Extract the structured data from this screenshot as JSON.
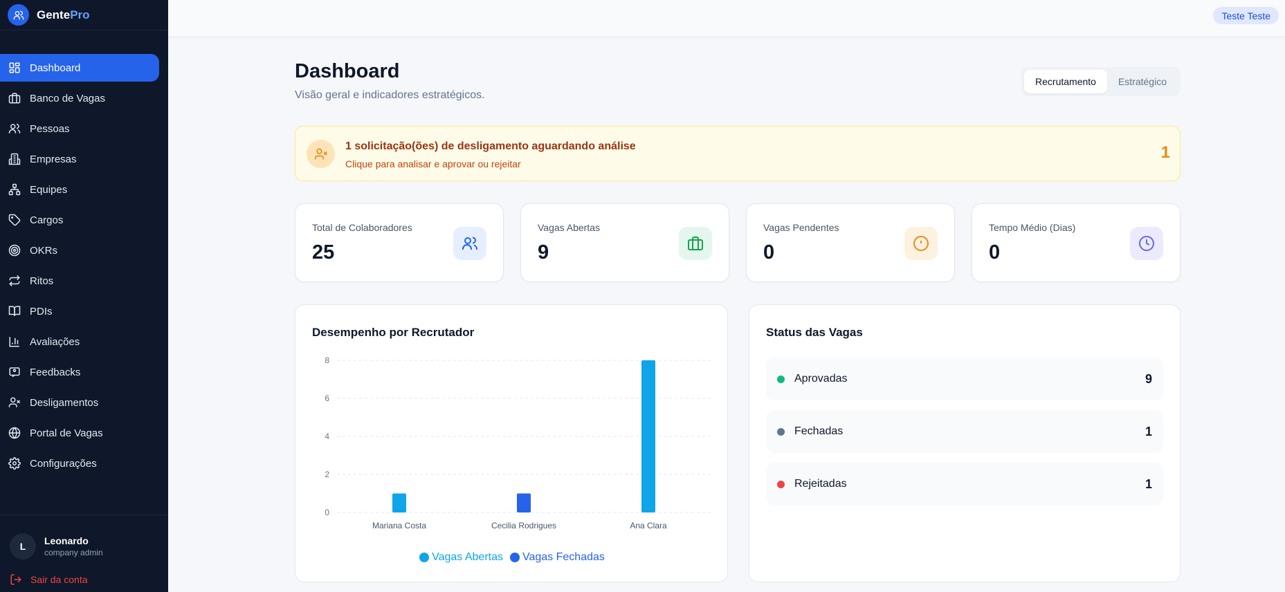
{
  "brand": {
    "name_a": "Gente",
    "name_b": "Pro"
  },
  "sidebar": {
    "items": [
      {
        "label": "Dashboard",
        "icon": "layout-grid-icon",
        "active": true
      },
      {
        "label": "Banco de Vagas",
        "icon": "briefcase-icon"
      },
      {
        "label": "Pessoas",
        "icon": "users-icon"
      },
      {
        "label": "Empresas",
        "icon": "building-icon"
      },
      {
        "label": "Equipes",
        "icon": "network-icon"
      },
      {
        "label": "Cargos",
        "icon": "tag-icon"
      },
      {
        "label": "OKRs",
        "icon": "target-icon"
      },
      {
        "label": "Ritos",
        "icon": "repeat-icon"
      },
      {
        "label": "PDIs",
        "icon": "book-icon"
      },
      {
        "label": "Avaliações",
        "icon": "bar-chart-icon"
      },
      {
        "label": "Feedbacks",
        "icon": "message-icon"
      },
      {
        "label": "Desligamentos",
        "icon": "user-x-icon"
      },
      {
        "label": "Portal de Vagas",
        "icon": "globe-icon"
      },
      {
        "label": "Configurações",
        "icon": "gear-icon"
      }
    ],
    "user": {
      "initial": "L",
      "name": "Leonardo",
      "role": "company admin"
    },
    "logout": "Sair da conta"
  },
  "topbar": {
    "user_chip": "Teste Teste"
  },
  "page": {
    "title": "Dashboard",
    "subtitle": "Visão geral e indicadores estratégicos.",
    "tabs": [
      {
        "label": "Recrutamento",
        "active": true
      },
      {
        "label": "Estratégico"
      }
    ]
  },
  "alert": {
    "title": "1 solicitação(ões) de desligamento aguardando análise",
    "subtitle": "Clique para analisar e aprovar ou rejeitar",
    "count": "1"
  },
  "stats": [
    {
      "label": "Total de Colaboradores",
      "value": "25",
      "icon": "users-icon",
      "color": "#2563eb",
      "bg": "#e6efff"
    },
    {
      "label": "Vagas Abertas",
      "value": "9",
      "icon": "briefcase-icon",
      "color": "#16a34a",
      "bg": "#e3f7ee"
    },
    {
      "label": "Vagas Pendentes",
      "value": "0",
      "icon": "alert-circle-icon",
      "color": "#ea8a1a",
      "bg": "#fdf1df"
    },
    {
      "label": "Tempo Médio (Dias)",
      "value": "0",
      "icon": "clock-icon",
      "color": "#6366f1",
      "bg": "#ecebfd"
    }
  ],
  "performance": {
    "title": "Desempenho por Recrutador"
  },
  "chart_data": {
    "type": "bar",
    "title": "Desempenho por Recrutador",
    "categories": [
      "Mariana Costa",
      "Cecilia Rodrigues",
      "Ana Clara"
    ],
    "series": [
      {
        "name": "Vagas Abertas",
        "values": [
          1,
          0,
          8
        ],
        "color": "#0ea5e9"
      },
      {
        "name": "Vagas Fechadas",
        "values": [
          0,
          1,
          0
        ],
        "color": "#2563eb"
      }
    ],
    "yticks": [
      0,
      2,
      4,
      6,
      8
    ],
    "ylim": [
      0,
      8
    ],
    "grid": true,
    "legend": "bottom-center"
  },
  "status": {
    "title": "Status das Vagas",
    "rows": [
      {
        "label": "Aprovadas",
        "count": "9",
        "color": "#10b981"
      },
      {
        "label": "Fechadas",
        "count": "1",
        "color": "#64748b"
      },
      {
        "label": "Rejeitadas",
        "count": "1",
        "color": "#ef4444"
      }
    ]
  }
}
